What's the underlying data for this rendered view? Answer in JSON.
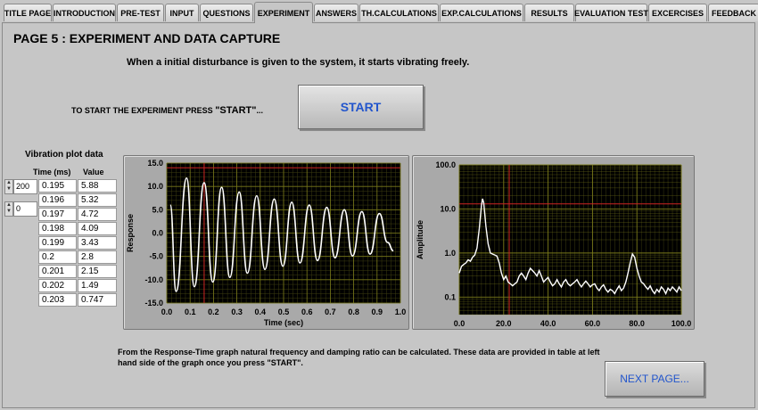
{
  "tabs": [
    {
      "label": "TITLE PAGE"
    },
    {
      "label": "INTRODUCTION"
    },
    {
      "label": "PRE-TEST"
    },
    {
      "label": "INPUT"
    },
    {
      "label": "QUESTIONS"
    },
    {
      "label": "EXPERIMENT",
      "active": true
    },
    {
      "label": "ANSWERS"
    },
    {
      "label": "TH.CALCULATIONS"
    },
    {
      "label": "EXP.CALCULATIONS"
    },
    {
      "label": "RESULTS"
    },
    {
      "label": "EVALUATION TEST"
    },
    {
      "label": "EXCERCISES"
    },
    {
      "label": "FEEDBACK"
    }
  ],
  "page": {
    "title": "PAGE 5 :  EXPERIMENT AND DATA CAPTURE",
    "subtitle": "When a initial disturbance is given to the system, it starts vibrating freely.",
    "start_prompt_prefix": "TO START THE EXPERIMENT PRESS ",
    "start_prompt_key": "\"START\"",
    "start_prompt_suffix": "...",
    "start_button": "START",
    "note": "From the Response-Time graph natural frequency and damping ratio can be calculated. These data are provided in table at left hand side of the graph once you press \"START\".",
    "next_button": "NEXT PAGE..."
  },
  "vibration_table": {
    "title": "Vibration plot data",
    "col_time": "Time (ms)",
    "col_value": "Value",
    "row_index": "200",
    "col_index": "0",
    "rows": [
      [
        "0.195",
        "5.88"
      ],
      [
        "0.196",
        "5.32"
      ],
      [
        "0.197",
        "4.72"
      ],
      [
        "0.198",
        "4.09"
      ],
      [
        "0.199",
        "3.43"
      ],
      [
        "0.2",
        "2.8"
      ],
      [
        "0.201",
        "2.15"
      ],
      [
        "0.202",
        "1.49"
      ],
      [
        "0.203",
        "0.747"
      ]
    ]
  },
  "colors": {
    "accent": "#2255cc",
    "plot_bg": "#000000",
    "grid_major": "#7a7a1a",
    "grid_minor": "#3e3e10",
    "cursor_h": "#cc2222",
    "cursor_v": "#cc2222",
    "trace": "#ffffff"
  },
  "chart_data": [
    {
      "type": "line",
      "xlabel": "Time (sec)",
      "ylabel": "Response",
      "xlim": [
        0,
        1.0
      ],
      "ylim": [
        -15,
        15
      ],
      "xticks": [
        "0.0",
        "0.1",
        "0.2",
        "0.3",
        "0.4",
        "0.5",
        "0.6",
        "0.7",
        "0.8",
        "0.9",
        "1.0"
      ],
      "yticks": [
        "15.0",
        "10.0",
        "5.0",
        "0.0",
        "-5.0",
        "-10.0",
        "-15.0"
      ],
      "cursor_x": 0.16,
      "cursor_y": 14.0,
      "signal": {
        "amplitude": 13,
        "frequency_hz": 13.2,
        "decay": 1.3,
        "t_end": 0.97
      },
      "peaks": [
        {
          "t": 0.015,
          "y": 6
        },
        {
          "t": 0.04,
          "y": -12.5
        },
        {
          "t": 0.085,
          "y": 11.8
        },
        {
          "t": 0.118,
          "y": -11.5
        },
        {
          "t": 0.16,
          "y": 10.8
        },
        {
          "t": 0.197,
          "y": -10.5
        },
        {
          "t": 0.235,
          "y": 9.8
        },
        {
          "t": 0.27,
          "y": -9.5
        },
        {
          "t": 0.31,
          "y": 8.8
        },
        {
          "t": 0.345,
          "y": -8.6
        },
        {
          "t": 0.385,
          "y": 8.0
        },
        {
          "t": 0.42,
          "y": -7.8
        },
        {
          "t": 0.46,
          "y": 7.3
        },
        {
          "t": 0.497,
          "y": -7.1
        },
        {
          "t": 0.535,
          "y": 6.6
        },
        {
          "t": 0.57,
          "y": -6.4
        },
        {
          "t": 0.61,
          "y": 6.0
        },
        {
          "t": 0.645,
          "y": -5.9
        },
        {
          "t": 0.685,
          "y": 5.5
        },
        {
          "t": 0.72,
          "y": -5.3
        },
        {
          "t": 0.76,
          "y": 5.0
        },
        {
          "t": 0.795,
          "y": -4.9
        },
        {
          "t": 0.835,
          "y": 4.6
        },
        {
          "t": 0.87,
          "y": -4.5
        },
        {
          "t": 0.91,
          "y": 4.2
        },
        {
          "t": 0.945,
          "y": -2.0
        },
        {
          "t": 0.97,
          "y": -3.8
        }
      ]
    },
    {
      "type": "line",
      "xlabel": "Frequency (Hz)",
      "ylabel": "Amplitude",
      "log_y": true,
      "xlim": [
        0,
        100
      ],
      "ylim": [
        0.05,
        100
      ],
      "xticks": [
        "0.0",
        "20.0",
        "40.0",
        "60.0",
        "80.0",
        "100.0"
      ],
      "yticks": [
        "100.0",
        "10.0",
        "1.0",
        "0.1"
      ],
      "cursor_x": 22.5,
      "cursor_y": 13.0,
      "points": [
        [
          0,
          0.35
        ],
        [
          1,
          0.5
        ],
        [
          2,
          0.55
        ],
        [
          3,
          0.6
        ],
        [
          4,
          0.7
        ],
        [
          5,
          0.65
        ],
        [
          6,
          0.8
        ],
        [
          7,
          0.9
        ],
        [
          8,
          1.3
        ],
        [
          9,
          3.5
        ],
        [
          10,
          12
        ],
        [
          10.5,
          17
        ],
        [
          11,
          14
        ],
        [
          12,
          4
        ],
        [
          13,
          1.6
        ],
        [
          14,
          1.0
        ],
        [
          15,
          0.95
        ],
        [
          16,
          0.9
        ],
        [
          17,
          0.85
        ],
        [
          18,
          0.6
        ],
        [
          19,
          0.35
        ],
        [
          20,
          0.25
        ],
        [
          21,
          0.3
        ],
        [
          22,
          0.22
        ],
        [
          23,
          0.2
        ],
        [
          24,
          0.18
        ],
        [
          25,
          0.2
        ],
        [
          26,
          0.22
        ],
        [
          27,
          0.3
        ],
        [
          28,
          0.35
        ],
        [
          29,
          0.3
        ],
        [
          30,
          0.25
        ],
        [
          31,
          0.35
        ],
        [
          32,
          0.45
        ],
        [
          33,
          0.4
        ],
        [
          34,
          0.35
        ],
        [
          35,
          0.3
        ],
        [
          36,
          0.4
        ],
        [
          37,
          0.3
        ],
        [
          38,
          0.22
        ],
        [
          39,
          0.25
        ],
        [
          40,
          0.28
        ],
        [
          41,
          0.22
        ],
        [
          42,
          0.18
        ],
        [
          43,
          0.2
        ],
        [
          44,
          0.25
        ],
        [
          45,
          0.2
        ],
        [
          46,
          0.17
        ],
        [
          47,
          0.22
        ],
        [
          48,
          0.25
        ],
        [
          49,
          0.2
        ],
        [
          50,
          0.18
        ],
        [
          51,
          0.2
        ],
        [
          52,
          0.22
        ],
        [
          53,
          0.25
        ],
        [
          54,
          0.2
        ],
        [
          55,
          0.17
        ],
        [
          56,
          0.2
        ],
        [
          57,
          0.23
        ],
        [
          58,
          0.2
        ],
        [
          59,
          0.17
        ],
        [
          60,
          0.19
        ],
        [
          61,
          0.2
        ],
        [
          62,
          0.16
        ],
        [
          63,
          0.14
        ],
        [
          64,
          0.17
        ],
        [
          65,
          0.19
        ],
        [
          66,
          0.15
        ],
        [
          67,
          0.13
        ],
        [
          68,
          0.15
        ],
        [
          69,
          0.14
        ],
        [
          70,
          0.12
        ],
        [
          71,
          0.15
        ],
        [
          72,
          0.18
        ],
        [
          73,
          0.14
        ],
        [
          74,
          0.16
        ],
        [
          75,
          0.22
        ],
        [
          76,
          0.35
        ],
        [
          77,
          0.6
        ],
        [
          78,
          0.95
        ],
        [
          79,
          0.8
        ],
        [
          80,
          0.45
        ],
        [
          81,
          0.3
        ],
        [
          82,
          0.22
        ],
        [
          83,
          0.2
        ],
        [
          84,
          0.17
        ],
        [
          85,
          0.15
        ],
        [
          86,
          0.18
        ],
        [
          87,
          0.14
        ],
        [
          88,
          0.12
        ],
        [
          89,
          0.15
        ],
        [
          90,
          0.13
        ],
        [
          91,
          0.17
        ],
        [
          92,
          0.15
        ],
        [
          93,
          0.12
        ],
        [
          94,
          0.16
        ],
        [
          95,
          0.14
        ],
        [
          96,
          0.17
        ],
        [
          97,
          0.15
        ],
        [
          98,
          0.13
        ],
        [
          99,
          0.17
        ],
        [
          100,
          0.14
        ]
      ]
    }
  ]
}
